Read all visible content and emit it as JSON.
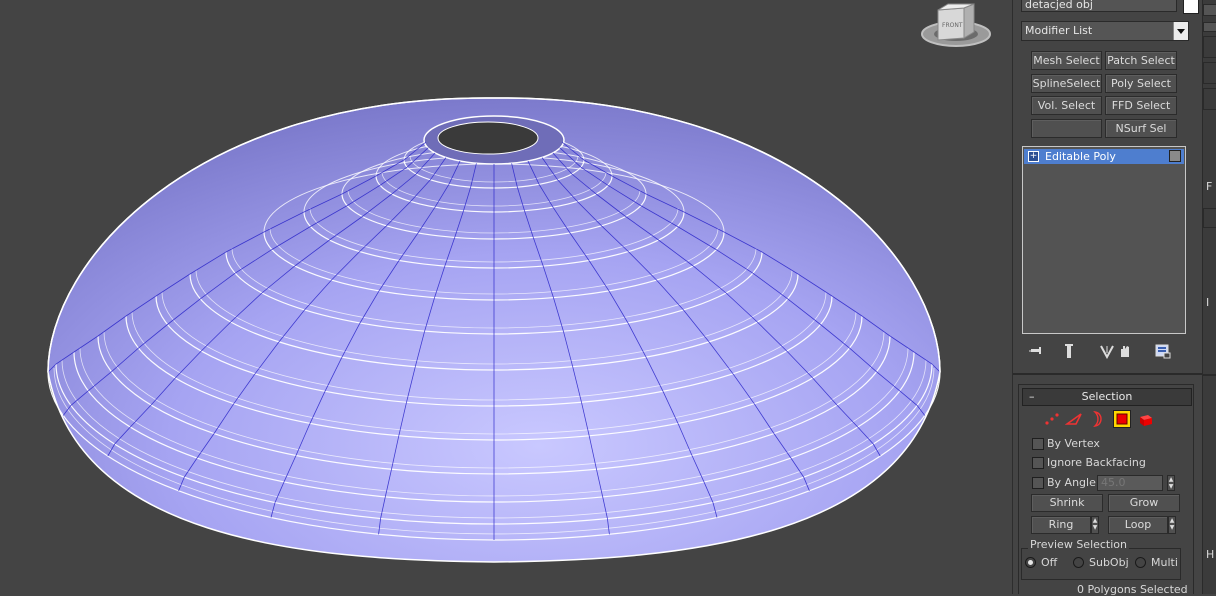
{
  "viewport": {
    "mesh_color": "#a6a4f2",
    "view_cube_label": "FRONT"
  },
  "command_panel": {
    "object_name": "detacjed obj",
    "object_color": "#ffffff",
    "modifier_list_label": "Modifier List",
    "modifier_buttons": [
      "Mesh Select",
      "Patch Select",
      "SplineSelect",
      "Poly Select",
      "Vol. Select",
      "FFD Select",
      "",
      "NSurf Sel"
    ],
    "stack": {
      "items": [
        {
          "label": "Editable Poly",
          "selected": true
        }
      ]
    },
    "stack_tools": [
      "pin-stack-icon",
      "show-end-result-icon",
      "make-unique-icon",
      "remove-modifier-icon",
      "configure-sets-icon"
    ]
  },
  "selection": {
    "title": "Selection",
    "collapse_glyph": "–",
    "levels": [
      "vertex",
      "edge",
      "border",
      "polygon",
      "element"
    ],
    "active_level": "polygon",
    "by_vertex": "By Vertex",
    "ignore_backfacing": "Ignore Backfacing",
    "by_angle": "By Angle:",
    "by_angle_value": "45.0",
    "shrink": "Shrink",
    "grow": "Grow",
    "ring": "Ring",
    "loop": "Loop",
    "preview_title": "Preview Selection",
    "preview_options": [
      "Off",
      "SubObj",
      "Multi"
    ],
    "preview_selected": "Off",
    "status": "0 Polygons Selected"
  },
  "far_right": {
    "letters": [
      "F",
      "I",
      "H"
    ]
  },
  "colors": {
    "viewport_bg": "#444444",
    "panel_bg": "#444444",
    "highlight": "#4e7ecf",
    "active_level": "#ffd800"
  }
}
